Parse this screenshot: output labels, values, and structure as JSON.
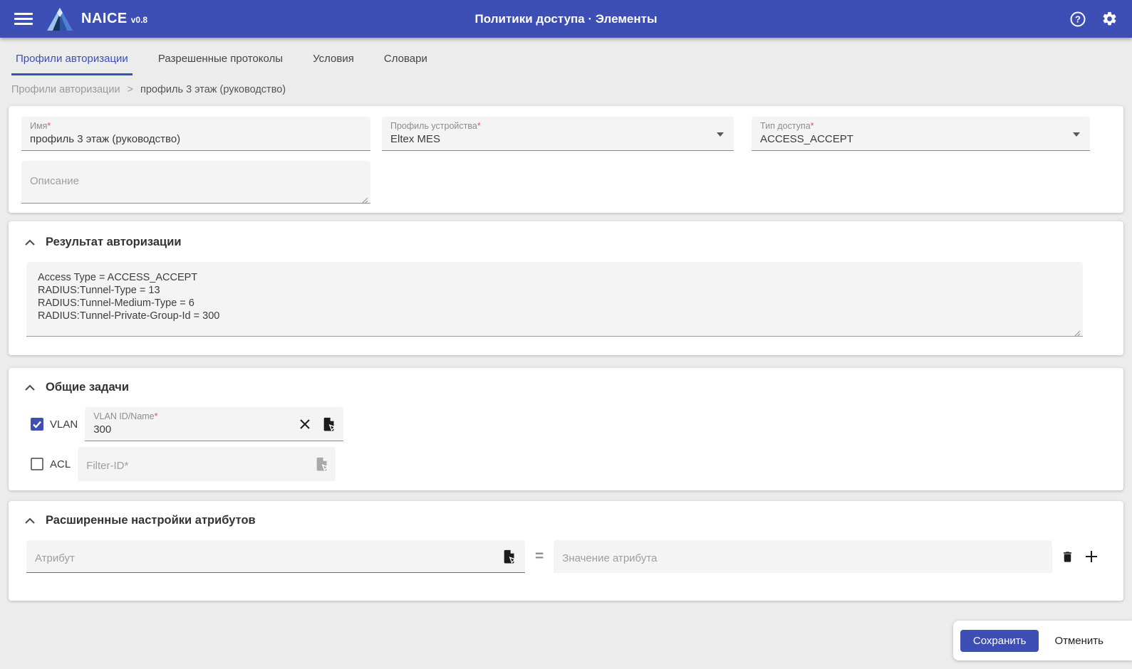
{
  "header": {
    "app_name": "NAICE",
    "app_version": "v0.8",
    "title": "Политики доступа · Элементы"
  },
  "tabs": [
    {
      "label": "Профили авторизации",
      "active": true
    },
    {
      "label": "Разрешенные протоколы",
      "active": false
    },
    {
      "label": "Условия",
      "active": false
    },
    {
      "label": "Словари",
      "active": false
    }
  ],
  "breadcrumb": {
    "parent": "Профили авторизации",
    "separator": ">",
    "current": "профиль 3 этаж (руководство)"
  },
  "form": {
    "name": {
      "label": "Имя",
      "required": "*",
      "value": "профиль 3 этаж (руководство)"
    },
    "device_profile": {
      "label": "Профиль устройства",
      "required": "*",
      "value": "Eltex MES"
    },
    "access_type": {
      "label": "Тип доступа",
      "required": "*",
      "value": "ACCESS_ACCEPT"
    },
    "description": {
      "placeholder": "Описание",
      "value": ""
    }
  },
  "auth_result": {
    "title": "Результат авторизации",
    "value": "Access Type = ACCESS_ACCEPT\nRADIUS:Tunnel-Type = 13\nRADIUS:Tunnel-Medium-Type = 6\nRADIUS:Tunnel-Private-Group-Id = 300"
  },
  "common_tasks": {
    "title": "Общие задачи",
    "vlan": {
      "checkbox_label": "VLAN",
      "checked": true,
      "field_label": "VLAN ID/Name",
      "required": "*",
      "value": "300"
    },
    "acl": {
      "checkbox_label": "ACL",
      "checked": false,
      "placeholder": "Filter-ID*"
    }
  },
  "advanced": {
    "title": "Расширенные настройки атрибутов",
    "attribute_placeholder": "Атрибут",
    "equals": "=",
    "value_placeholder": "Значение атрибута"
  },
  "actions": {
    "save": "Сохранить",
    "cancel": "Отменить"
  },
  "colors": {
    "primary": "#3d4eb5",
    "page_background": "#ececec",
    "required_asterisk": "#e0554d",
    "card_background": "#ffffff"
  }
}
